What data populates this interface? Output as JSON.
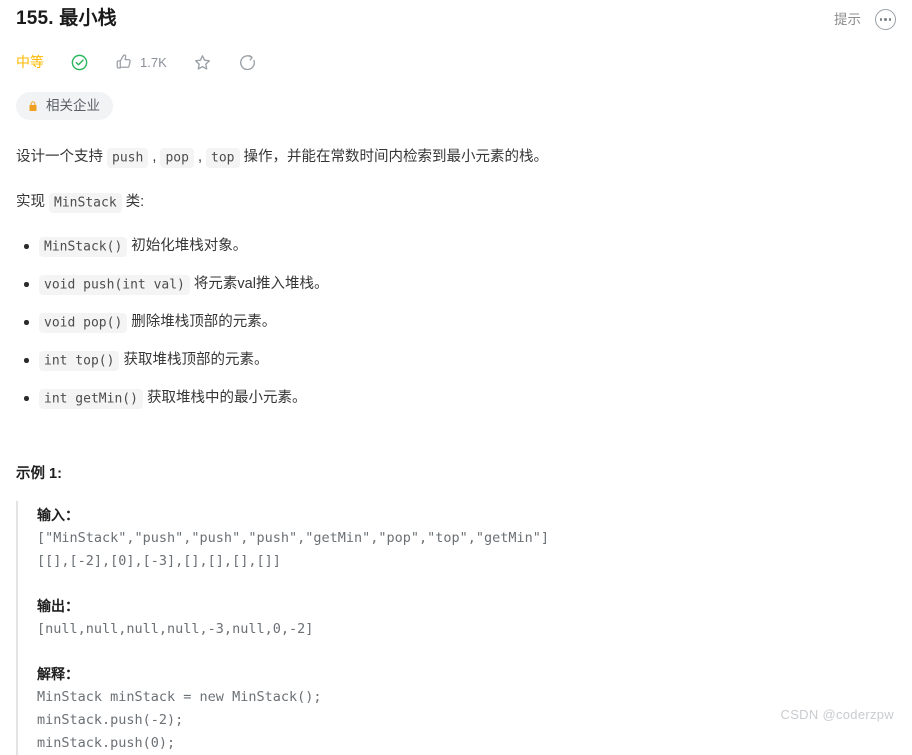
{
  "header": {
    "title": "155. 最小栈",
    "hint_label": "提示",
    "more_icon": "more-options-icon"
  },
  "meta": {
    "difficulty": "中等",
    "solved_icon": "check-circle-icon",
    "like_icon": "thumbs-up-icon",
    "like_count": "1.7K",
    "favorite_icon": "star-icon",
    "share_icon": "share-icon"
  },
  "company_tag": {
    "lock_icon": "lock-icon",
    "label": "相关企业"
  },
  "description": {
    "line1_a": "设计一个支持 ",
    "code_push": "push",
    "sep1": " , ",
    "code_pop": "pop",
    "sep2": " , ",
    "code_top": "top",
    "line1_b": " 操作，并能在常数时间内检索到最小元素的栈。",
    "line2_a": "实现 ",
    "code_minstack": "MinStack",
    "line2_b": " 类:"
  },
  "methods": [
    {
      "code": "MinStack()",
      "text": " 初始化堆栈对象。"
    },
    {
      "code": "void push(int val)",
      "text": " 将元素val推入堆栈。"
    },
    {
      "code": "void pop()",
      "text": " 删除堆栈顶部的元素。"
    },
    {
      "code": "int top()",
      "text": " 获取堆栈顶部的元素。"
    },
    {
      "code": "int getMin()",
      "text": " 获取堆栈中的最小元素。"
    }
  ],
  "example": {
    "heading": "示例 1:",
    "input_label": "输入：",
    "input_lines": "[\"MinStack\",\"push\",\"push\",\"push\",\"getMin\",\"pop\",\"top\",\"getMin\"]\n[[],[-2],[0],[-3],[],[],[],[]]",
    "output_label": "输出：",
    "output_lines": "[null,null,null,null,-3,null,0,-2]",
    "explain_label": "解释：",
    "explain_lines": "MinStack minStack = new MinStack();\nminStack.push(-2);\nminStack.push(0);"
  },
  "watermark": "CSDN @coderzpw",
  "colors": {
    "difficulty": "#ffb800",
    "solved_green": "#2db55d",
    "lock_orange": "#f0a020",
    "text": "#363636",
    "muted": "#8c8c8c"
  }
}
